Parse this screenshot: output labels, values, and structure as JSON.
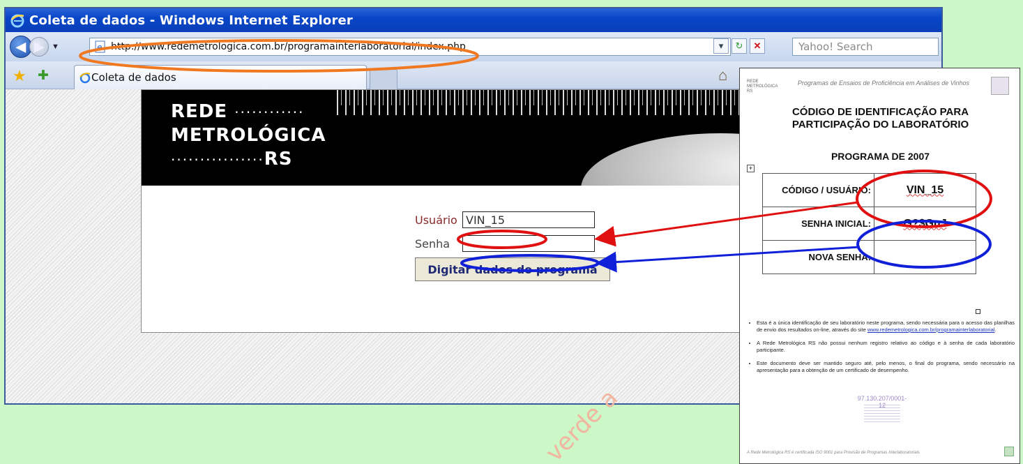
{
  "window": {
    "title": "Coleta de dados - Windows Internet Explorer"
  },
  "addressbar": {
    "url": "http://www.redemetrologica.com.br/programainterlaboratorial/index.php",
    "search_placeholder": "Yahoo! Search"
  },
  "tabs": [
    {
      "label": "Coleta de dados"
    }
  ],
  "banner": {
    "logo_line1": "REDE",
    "logo_line2": "METROLÓGICA",
    "logo_line3": "RS",
    "logo_dots1": "············",
    "logo_dots3": "················"
  },
  "form": {
    "user_label": "Usuário",
    "user_value": "VIN_15",
    "pass_label": "Senha",
    "pass_value": "",
    "submit_label": "Digitar dados do programa"
  },
  "document": {
    "org": "REDE METROLÓGICA RS",
    "header_title": "Programas de Ensaios de Proficiência em Análises de Vinhos",
    "title_line1": "CÓDIGO DE IDENTIFICAÇÃO PARA",
    "title_line2": "PARTICIPAÇÃO DO LABORATÓRIO",
    "program": "PROGRAMA DE 2007",
    "rows": [
      {
        "label": "CÓDIGO / USUÁRIO:",
        "value": "VIN_15"
      },
      {
        "label": "SENHA INICIAL:",
        "value": "G?$GuJ"
      },
      {
        "label": "NOVA SENHA:",
        "value": ""
      }
    ],
    "bullets": [
      "Esta é a única identificação de seu laboratório neste programa, sendo necessária para o acesso das planilhas de envio dos resultados on-line, através do site",
      "A Rede Metrológica RS não possui nenhum registro relativo ao código e à senha de cada laboratório participante.",
      "Este documento deve ser mantido seguro até, pelo menos, o final do programa, sendo necessário na apresentação para a obtenção de um certificado de desempenho."
    ],
    "bullet1_link": "www.redemetrologica.com.br/programainterlaboratorial",
    "stamp": "97.130.207/0001-12",
    "footer": "A Rede Metrológica RS é certificada ISO 9001 para Provisão de Programas Interlaboratoriais"
  },
  "watermark": "verde a",
  "annotation_colors": {
    "orange": "#f07820",
    "red": "#e01010",
    "blue": "#1020d8"
  }
}
